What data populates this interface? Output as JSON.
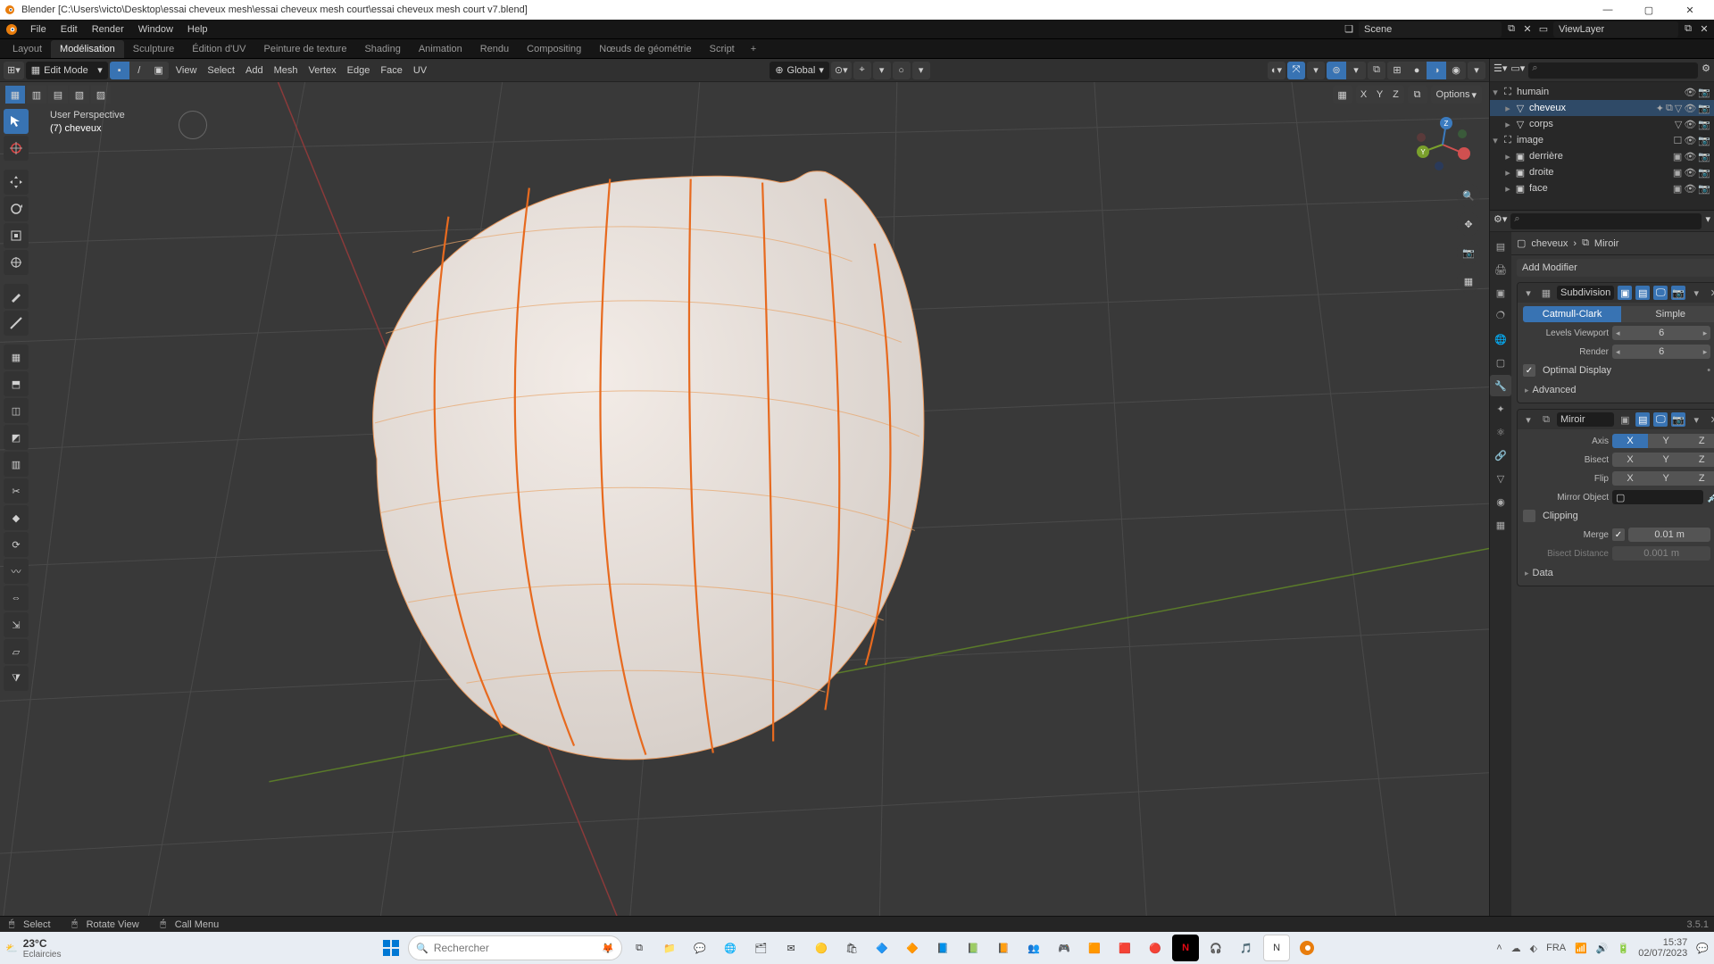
{
  "titlebar": {
    "title": "Blender [C:\\Users\\victo\\Desktop\\essai cheveux mesh\\essai cheveux mesh court\\essai cheveux mesh court v7.blend]"
  },
  "menubar": {
    "items": [
      "File",
      "Edit",
      "Render",
      "Window",
      "Help"
    ],
    "scene_label": "Scene",
    "layer_label": "ViewLayer"
  },
  "workspace_tabs": [
    "Layout",
    "Modélisation",
    "Sculpture",
    "Édition d'UV",
    "Peinture de texture",
    "Shading",
    "Animation",
    "Rendu",
    "Compositing",
    "Nœuds de géométrie",
    "Script"
  ],
  "workspace_active": 1,
  "vp_header": {
    "mode": "Edit Mode",
    "menus": [
      "View",
      "Select",
      "Add",
      "Mesh",
      "Vertex",
      "Edge",
      "Face",
      "UV"
    ],
    "orient": "Global",
    "options": "Options"
  },
  "vp_label": {
    "persp": "User Perspective",
    "obj": "(7) cheveux"
  },
  "outliner": {
    "rows": [
      {
        "indent": 0,
        "disc": "▾",
        "icon": "⛶",
        "label": "humain",
        "tail": [
          "👁",
          "📷"
        ],
        "class": ""
      },
      {
        "indent": 1,
        "disc": "▸",
        "icon": "▽",
        "label": "cheveux",
        "tail": [
          "✦",
          "⧉",
          "▽",
          "👁",
          "📷"
        ],
        "class": "sel"
      },
      {
        "indent": 1,
        "disc": "▸",
        "icon": "▽",
        "label": "corps",
        "tail": [
          "▽",
          "👁",
          "📷"
        ],
        "class": ""
      },
      {
        "indent": 0,
        "disc": "▾",
        "icon": "⛶",
        "label": "image",
        "tail": [
          "☐",
          "👁",
          "📷"
        ],
        "class": ""
      },
      {
        "indent": 1,
        "disc": "▸",
        "icon": "▣",
        "label": "derrière",
        "tail": [
          "▣",
          "👁",
          "📷"
        ],
        "class": ""
      },
      {
        "indent": 1,
        "disc": "▸",
        "icon": "▣",
        "label": "droite",
        "tail": [
          "▣",
          "👁",
          "📷"
        ],
        "class": ""
      },
      {
        "indent": 1,
        "disc": "▸",
        "icon": "▣",
        "label": "face",
        "tail": [
          "▣",
          "👁",
          "📷"
        ],
        "class": ""
      }
    ]
  },
  "props": {
    "crumb_obj": "cheveux",
    "crumb_mod": "Miroir",
    "add": "Add Modifier",
    "subdiv": {
      "name": "Subdivision",
      "type_a": "Catmull-Clark",
      "type_b": "Simple",
      "levels_label": "Levels Viewport",
      "levels_val": "6",
      "render_label": "Render",
      "render_val": "6",
      "optimal": "Optimal Display",
      "advanced": "Advanced"
    },
    "mirror": {
      "name": "Miroir",
      "axis_label": "Axis",
      "bisect_label": "Bisect",
      "flip_label": "Flip",
      "x": "X",
      "y": "Y",
      "z": "Z",
      "mirrorobj_label": "Mirror Object",
      "clipping": "Clipping",
      "merge_label": "Merge",
      "merge_val": "0.01 m",
      "bisectdist_label": "Bisect Distance",
      "bisectdist_val": "0.001 m",
      "data": "Data"
    }
  },
  "status": {
    "select": "Select",
    "rotate": "Rotate View",
    "menu": "Call Menu",
    "version": "3.5.1"
  },
  "taskbar": {
    "temp": "23°C",
    "weather": "Eclaircies",
    "search_ph": "Rechercher",
    "time": "15:37",
    "date": "02/07/2023"
  }
}
